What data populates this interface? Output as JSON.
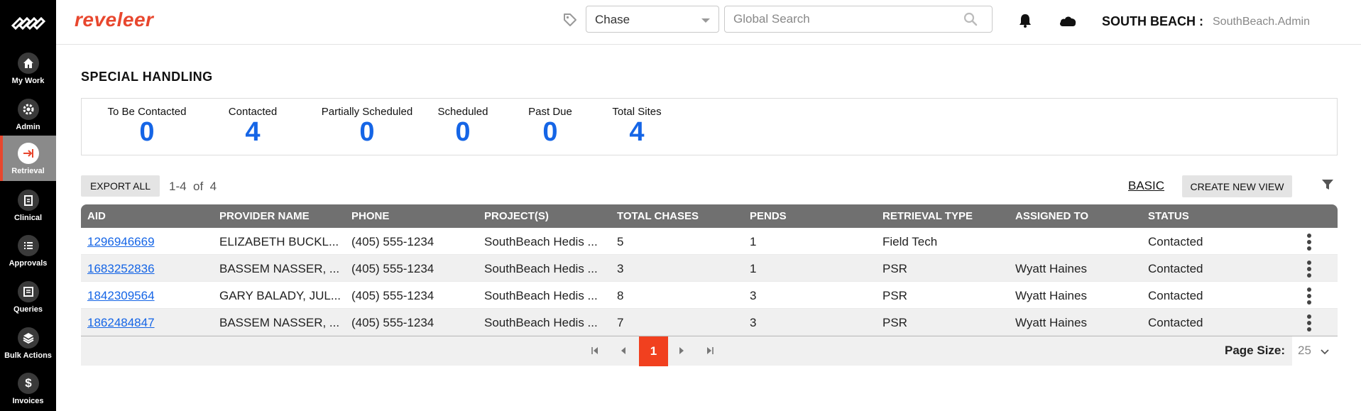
{
  "app": {
    "brand": "reveleer"
  },
  "sidebar": {
    "items": [
      {
        "label": "My Work",
        "icon": "home-icon"
      },
      {
        "label": "Admin",
        "icon": "gear-icon"
      },
      {
        "label": "Retrieval",
        "icon": "retrieval-arrow-icon",
        "active": true
      },
      {
        "label": "Clinical",
        "icon": "clinical-clipboard-icon"
      },
      {
        "label": "Approvals",
        "icon": "checklist-icon"
      },
      {
        "label": "Queries",
        "icon": "queries-list-icon"
      },
      {
        "label": "Bulk Actions",
        "icon": "layers-icon"
      },
      {
        "label": "Invoices",
        "icon": "dollar-icon"
      }
    ]
  },
  "header": {
    "search_scope": "Chase",
    "search_placeholder": "Global Search",
    "org": "SOUTH BEACH :",
    "user": "SouthBeach.Admin"
  },
  "page": {
    "title": "SPECIAL HANDLING"
  },
  "stats": [
    {
      "label": "To Be Contacted",
      "value": "0"
    },
    {
      "label": "Contacted",
      "value": "4"
    },
    {
      "label": "Partially Scheduled",
      "value": "0"
    },
    {
      "label": "Scheduled",
      "value": "0"
    },
    {
      "label": "Past Due",
      "value": "0"
    },
    {
      "label": "Total Sites",
      "value": "4"
    }
  ],
  "toolbar": {
    "export_label": "EXPORT ALL",
    "range": "1-4  of  4",
    "basic_label": "BASIC",
    "create_view_label": "CREATE NEW VIEW"
  },
  "grid": {
    "columns": [
      "AID",
      "PROVIDER NAME",
      "PHONE",
      "PROJECT(S)",
      "TOTAL CHASES",
      "PENDS",
      "RETRIEVAL TYPE",
      "ASSIGNED TO",
      "STATUS"
    ],
    "rows": [
      {
        "aid": "1296946669",
        "provider": "ELIZABETH BUCKL...",
        "phone": "(405) 555-1234",
        "project": "SouthBeach Hedis ...",
        "total_chases": "5",
        "pends": "1",
        "retrieval_type": "Field Tech",
        "assigned_to": "",
        "status": "Contacted"
      },
      {
        "aid": "1683252836",
        "provider": "BASSEM NASSER, ...",
        "phone": "(405) 555-1234",
        "project": "SouthBeach Hedis ...",
        "total_chases": "3",
        "pends": "1",
        "retrieval_type": "PSR",
        "assigned_to": "Wyatt Haines",
        "status": "Contacted"
      },
      {
        "aid": "1842309564",
        "provider": "GARY BALADY, JUL...",
        "phone": "(405) 555-1234",
        "project": "SouthBeach Hedis ...",
        "total_chases": "8",
        "pends": "3",
        "retrieval_type": "PSR",
        "assigned_to": "Wyatt Haines",
        "status": "Contacted"
      },
      {
        "aid": "1862484847",
        "provider": "BASSEM NASSER, ...",
        "phone": "(405) 555-1234",
        "project": "SouthBeach Hedis ...",
        "total_chases": "7",
        "pends": "3",
        "retrieval_type": "PSR",
        "assigned_to": "Wyatt Haines",
        "status": "Contacted"
      }
    ]
  },
  "pager": {
    "current_page": "1",
    "page_size_label": "Page Size:",
    "page_size": "25"
  },
  "colors": {
    "brand": "#e8472e",
    "accent_blue": "#1565e6",
    "page_active": "#f1401f",
    "grid_header": "#707070"
  }
}
